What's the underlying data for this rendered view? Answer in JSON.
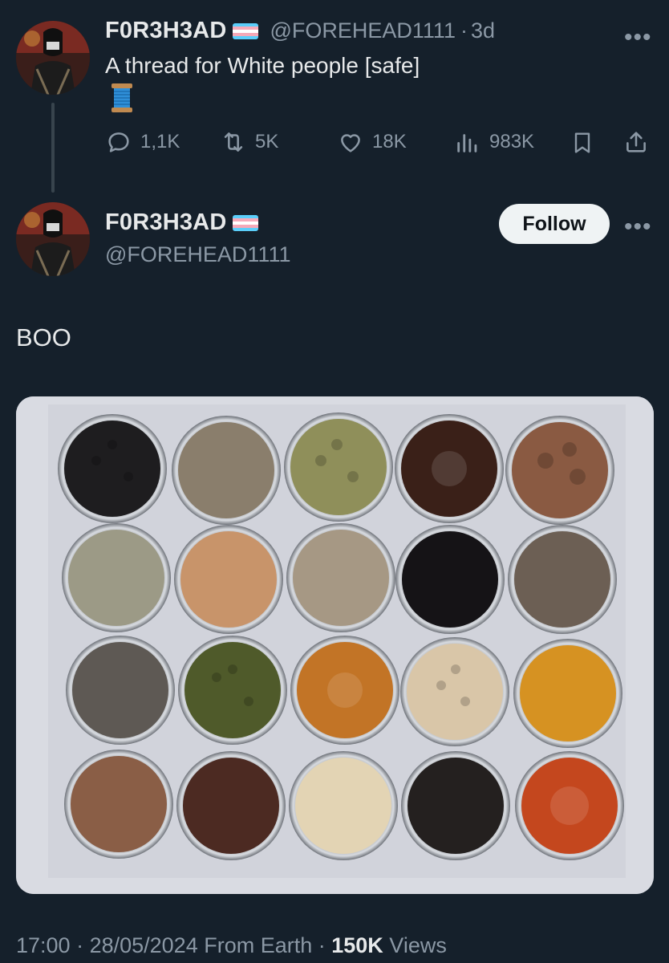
{
  "tweet1": {
    "name": "F0R3H3AD",
    "handle": "@FOREHEAD1111",
    "separator": "·",
    "time": "3d",
    "text": "A thread for White people [safe]",
    "emoji": "spool-of-thread-emoji",
    "more": "•••",
    "stats": {
      "replies": "1,1K",
      "retweets": "5K",
      "likes": "18K",
      "views": "983K"
    }
  },
  "tweet2": {
    "name": "F0R3H3AD",
    "handle": "@FOREHEAD1111",
    "follow_label": "Follow",
    "more": "•••",
    "text": "BOO"
  },
  "footer": {
    "time": "17:00",
    "sep1": " · ",
    "date": "28/05/2024",
    "source": " From Earth",
    "sep2": " · ",
    "views_count": "150K",
    "views_label": " Views"
  },
  "icons": [
    "reply-icon",
    "retweet-icon",
    "like-icon",
    "views-icon",
    "bookmark-icon",
    "share-icon",
    "trans-flag-icon"
  ],
  "colors": {
    "background": "#15202b",
    "text": "#e7e9ea",
    "muted": "#8b98a5",
    "follow_bg": "#eff3f4",
    "flag_blue": "#5bcefa",
    "flag_pink": "#f5a9b8"
  }
}
